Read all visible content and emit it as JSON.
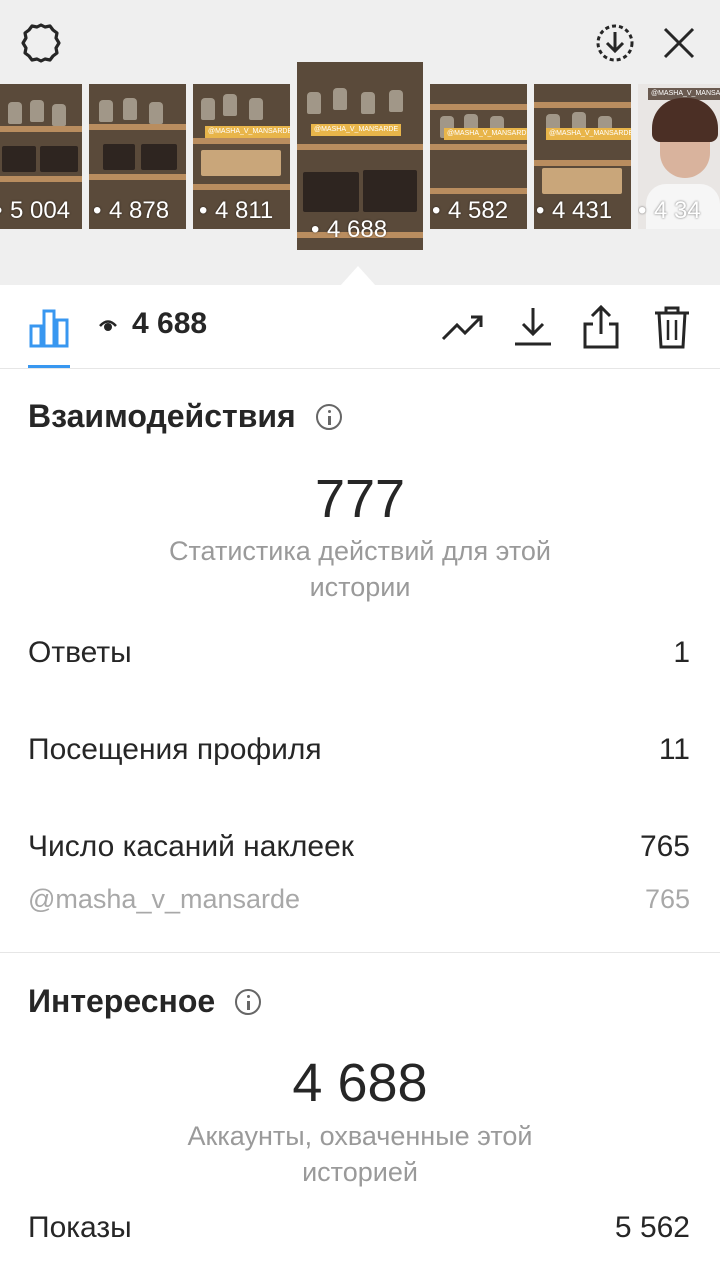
{
  "header": {
    "settings_icon": "settings-gear-icon",
    "download_icon": "download-circle-icon",
    "close_icon": "close-icon"
  },
  "stories": [
    {
      "views": "5 004",
      "sticker": "",
      "kind": "shelf"
    },
    {
      "views": "4 878",
      "sticker": "",
      "kind": "shelf"
    },
    {
      "views": "4 811",
      "sticker": "@MASHA_V_MANSARDE",
      "kind": "shelf"
    },
    {
      "views": "4 688",
      "sticker": "@MASHA_V_MANSARDE",
      "kind": "shelf",
      "selected": true
    },
    {
      "views": "4 582",
      "sticker": "@MASHA_V_MANSARDE",
      "kind": "shelf"
    },
    {
      "views": "4 431",
      "sticker": "@MASHA_V_MANSARDE",
      "kind": "shelf"
    },
    {
      "views": "4 34",
      "sticker": "@MASHA_V_MANSARDE",
      "kind": "portrait"
    }
  ],
  "toolbar": {
    "views": "4 688",
    "icons": [
      "stats-bars-icon",
      "eye-icon",
      "trend-icon",
      "download-icon",
      "share-icon",
      "trash-icon"
    ]
  },
  "interactions": {
    "title": "Взаимодействия",
    "total": "777",
    "caption": "Статистика действий для этой истории",
    "rows": [
      {
        "label": "Ответы",
        "value": "1"
      },
      {
        "label": "Посещения профиля",
        "value": "11"
      },
      {
        "label": "Число касаний наклеек",
        "value": "765"
      }
    ],
    "sub_row": {
      "label": "@masha_v_mansarde",
      "value": "765"
    }
  },
  "discovery": {
    "title": "Интересное",
    "total": "4 688",
    "caption": "Аккаунты, охваченные этой историей",
    "rows": [
      {
        "label": "Показы",
        "value": "5 562"
      }
    ]
  },
  "colors": {
    "accent": "#3897f0",
    "text": "#262626",
    "muted": "#9a9a9a",
    "strip_bg": "#efefef"
  }
}
